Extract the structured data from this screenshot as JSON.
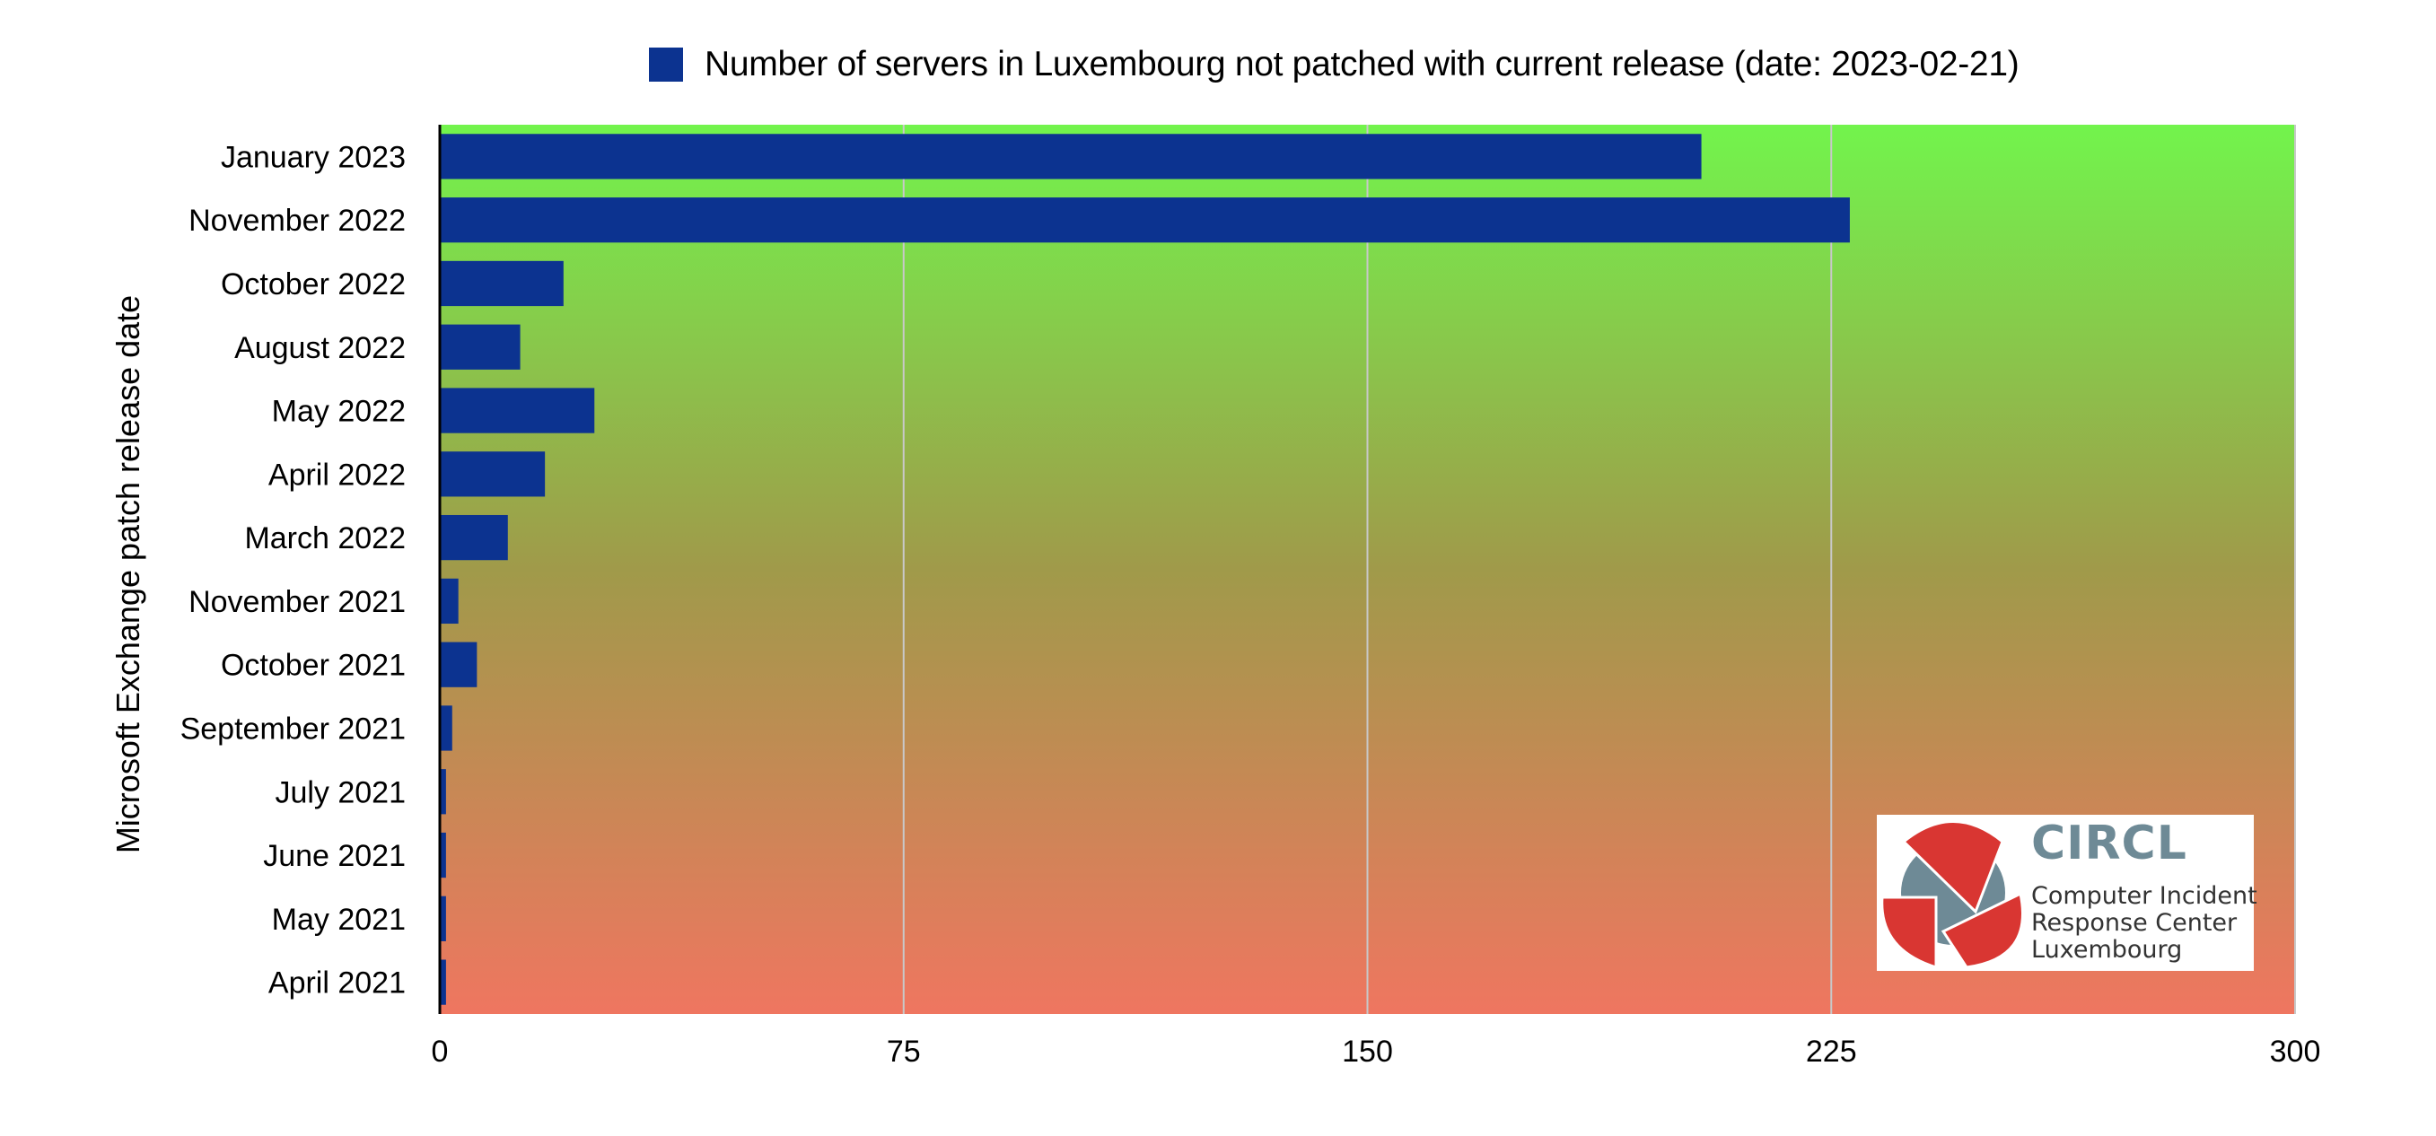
{
  "chart_data": {
    "type": "bar",
    "orientation": "horizontal",
    "title": "",
    "xlabel": "",
    "ylabel": "Microsoft Exchange patch release date",
    "xlim": [
      0,
      300
    ],
    "xticks": [
      0,
      75,
      150,
      225,
      300
    ],
    "grid": "vertical",
    "legend_position": "top-center",
    "categories": [
      "January 2023",
      "November 2022",
      "October 2022",
      "August 2022",
      "May 2022",
      "April 2022",
      "March 2022",
      "November 2021",
      "October 2021",
      "September 2021",
      "July 2021",
      "June 2021",
      "May 2021",
      "April 2021"
    ],
    "series": [
      {
        "name": "Number of servers in Luxembourg not patched with current release (date: 2023-02-21)",
        "color": "#0c3390",
        "values": [
          204,
          228,
          20,
          13,
          25,
          17,
          11,
          3,
          6,
          2,
          1,
          1,
          1,
          1
        ]
      }
    ],
    "background_gradient": {
      "top": "#72f44c",
      "middle": "#a09a4a",
      "bottom": "#ef7660"
    },
    "gridline_color": "#c8c8c8"
  },
  "logo": {
    "name": "CIRCL",
    "subtitle_lines": [
      "Computer Incident",
      "Response Center",
      "Luxembourg"
    ],
    "red": "#d93632",
    "grey": "#6e8a96"
  }
}
